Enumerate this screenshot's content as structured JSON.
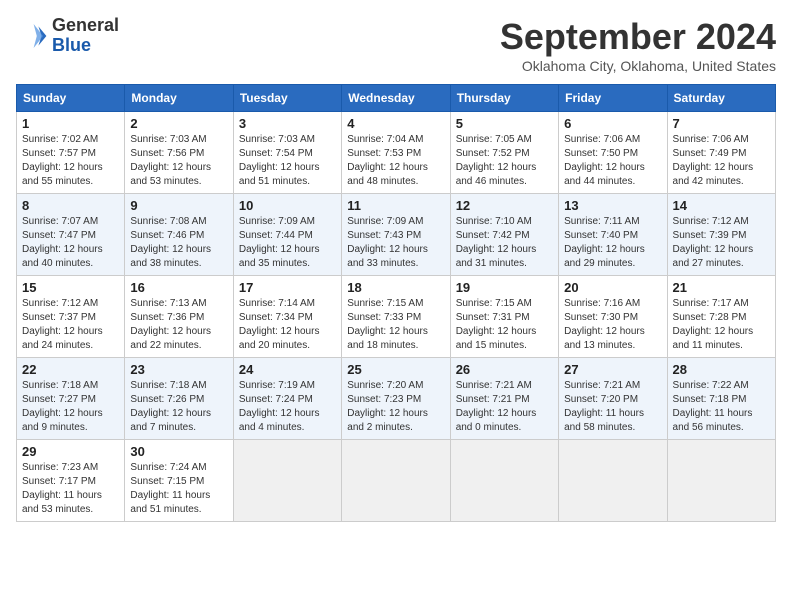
{
  "header": {
    "logo_line1": "General",
    "logo_line2": "Blue",
    "month_title": "September 2024",
    "location": "Oklahoma City, Oklahoma, United States"
  },
  "weekdays": [
    "Sunday",
    "Monday",
    "Tuesday",
    "Wednesday",
    "Thursday",
    "Friday",
    "Saturday"
  ],
  "weeks": [
    [
      {
        "day": "1",
        "lines": [
          "Sunrise: 7:02 AM",
          "Sunset: 7:57 PM",
          "Daylight: 12 hours",
          "and 55 minutes."
        ]
      },
      {
        "day": "2",
        "lines": [
          "Sunrise: 7:03 AM",
          "Sunset: 7:56 PM",
          "Daylight: 12 hours",
          "and 53 minutes."
        ]
      },
      {
        "day": "3",
        "lines": [
          "Sunrise: 7:03 AM",
          "Sunset: 7:54 PM",
          "Daylight: 12 hours",
          "and 51 minutes."
        ]
      },
      {
        "day": "4",
        "lines": [
          "Sunrise: 7:04 AM",
          "Sunset: 7:53 PM",
          "Daylight: 12 hours",
          "and 48 minutes."
        ]
      },
      {
        "day": "5",
        "lines": [
          "Sunrise: 7:05 AM",
          "Sunset: 7:52 PM",
          "Daylight: 12 hours",
          "and 46 minutes."
        ]
      },
      {
        "day": "6",
        "lines": [
          "Sunrise: 7:06 AM",
          "Sunset: 7:50 PM",
          "Daylight: 12 hours",
          "and 44 minutes."
        ]
      },
      {
        "day": "7",
        "lines": [
          "Sunrise: 7:06 AM",
          "Sunset: 7:49 PM",
          "Daylight: 12 hours",
          "and 42 minutes."
        ]
      }
    ],
    [
      {
        "day": "8",
        "lines": [
          "Sunrise: 7:07 AM",
          "Sunset: 7:47 PM",
          "Daylight: 12 hours",
          "and 40 minutes."
        ]
      },
      {
        "day": "9",
        "lines": [
          "Sunrise: 7:08 AM",
          "Sunset: 7:46 PM",
          "Daylight: 12 hours",
          "and 38 minutes."
        ]
      },
      {
        "day": "10",
        "lines": [
          "Sunrise: 7:09 AM",
          "Sunset: 7:44 PM",
          "Daylight: 12 hours",
          "and 35 minutes."
        ]
      },
      {
        "day": "11",
        "lines": [
          "Sunrise: 7:09 AM",
          "Sunset: 7:43 PM",
          "Daylight: 12 hours",
          "and 33 minutes."
        ]
      },
      {
        "day": "12",
        "lines": [
          "Sunrise: 7:10 AM",
          "Sunset: 7:42 PM",
          "Daylight: 12 hours",
          "and 31 minutes."
        ]
      },
      {
        "day": "13",
        "lines": [
          "Sunrise: 7:11 AM",
          "Sunset: 7:40 PM",
          "Daylight: 12 hours",
          "and 29 minutes."
        ]
      },
      {
        "day": "14",
        "lines": [
          "Sunrise: 7:12 AM",
          "Sunset: 7:39 PM",
          "Daylight: 12 hours",
          "and 27 minutes."
        ]
      }
    ],
    [
      {
        "day": "15",
        "lines": [
          "Sunrise: 7:12 AM",
          "Sunset: 7:37 PM",
          "Daylight: 12 hours",
          "and 24 minutes."
        ]
      },
      {
        "day": "16",
        "lines": [
          "Sunrise: 7:13 AM",
          "Sunset: 7:36 PM",
          "Daylight: 12 hours",
          "and 22 minutes."
        ]
      },
      {
        "day": "17",
        "lines": [
          "Sunrise: 7:14 AM",
          "Sunset: 7:34 PM",
          "Daylight: 12 hours",
          "and 20 minutes."
        ]
      },
      {
        "day": "18",
        "lines": [
          "Sunrise: 7:15 AM",
          "Sunset: 7:33 PM",
          "Daylight: 12 hours",
          "and 18 minutes."
        ]
      },
      {
        "day": "19",
        "lines": [
          "Sunrise: 7:15 AM",
          "Sunset: 7:31 PM",
          "Daylight: 12 hours",
          "and 15 minutes."
        ]
      },
      {
        "day": "20",
        "lines": [
          "Sunrise: 7:16 AM",
          "Sunset: 7:30 PM",
          "Daylight: 12 hours",
          "and 13 minutes."
        ]
      },
      {
        "day": "21",
        "lines": [
          "Sunrise: 7:17 AM",
          "Sunset: 7:28 PM",
          "Daylight: 12 hours",
          "and 11 minutes."
        ]
      }
    ],
    [
      {
        "day": "22",
        "lines": [
          "Sunrise: 7:18 AM",
          "Sunset: 7:27 PM",
          "Daylight: 12 hours",
          "and 9 minutes."
        ]
      },
      {
        "day": "23",
        "lines": [
          "Sunrise: 7:18 AM",
          "Sunset: 7:26 PM",
          "Daylight: 12 hours",
          "and 7 minutes."
        ]
      },
      {
        "day": "24",
        "lines": [
          "Sunrise: 7:19 AM",
          "Sunset: 7:24 PM",
          "Daylight: 12 hours",
          "and 4 minutes."
        ]
      },
      {
        "day": "25",
        "lines": [
          "Sunrise: 7:20 AM",
          "Sunset: 7:23 PM",
          "Daylight: 12 hours",
          "and 2 minutes."
        ]
      },
      {
        "day": "26",
        "lines": [
          "Sunrise: 7:21 AM",
          "Sunset: 7:21 PM",
          "Daylight: 12 hours",
          "and 0 minutes."
        ]
      },
      {
        "day": "27",
        "lines": [
          "Sunrise: 7:21 AM",
          "Sunset: 7:20 PM",
          "Daylight: 11 hours",
          "and 58 minutes."
        ]
      },
      {
        "day": "28",
        "lines": [
          "Sunrise: 7:22 AM",
          "Sunset: 7:18 PM",
          "Daylight: 11 hours",
          "and 56 minutes."
        ]
      }
    ],
    [
      {
        "day": "29",
        "lines": [
          "Sunrise: 7:23 AM",
          "Sunset: 7:17 PM",
          "Daylight: 11 hours",
          "and 53 minutes."
        ]
      },
      {
        "day": "30",
        "lines": [
          "Sunrise: 7:24 AM",
          "Sunset: 7:15 PM",
          "Daylight: 11 hours",
          "and 51 minutes."
        ]
      },
      null,
      null,
      null,
      null,
      null
    ]
  ]
}
